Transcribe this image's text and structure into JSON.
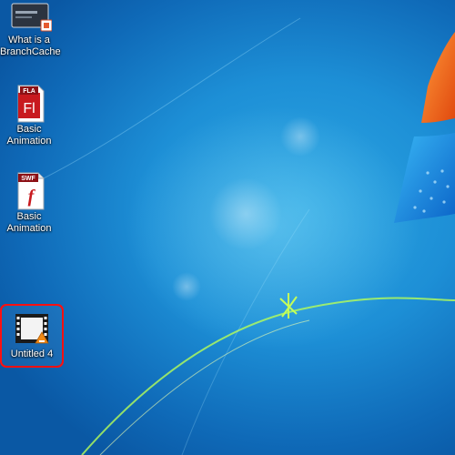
{
  "desktop": {
    "icons": [
      {
        "line1": "What is a",
        "line2": "BranchCache",
        "type": "video-thumbnail"
      },
      {
        "line1": "Basic",
        "line2": "Animation",
        "type": "flash-fla-file",
        "badge": "FLA",
        "glyph": "Fl"
      },
      {
        "line1": "Basic",
        "line2": "Animation",
        "type": "flash-swf-file",
        "badge": "SWF",
        "glyph": "f"
      },
      {
        "line1": "Untitled 4",
        "type": "video-file",
        "selected": true
      }
    ]
  },
  "colors": {
    "highlight": "#ff1010",
    "wallpaper_blue": "#1d8fd6",
    "logo_orange": "#f36a1b",
    "flash_red": "#c8191e"
  }
}
